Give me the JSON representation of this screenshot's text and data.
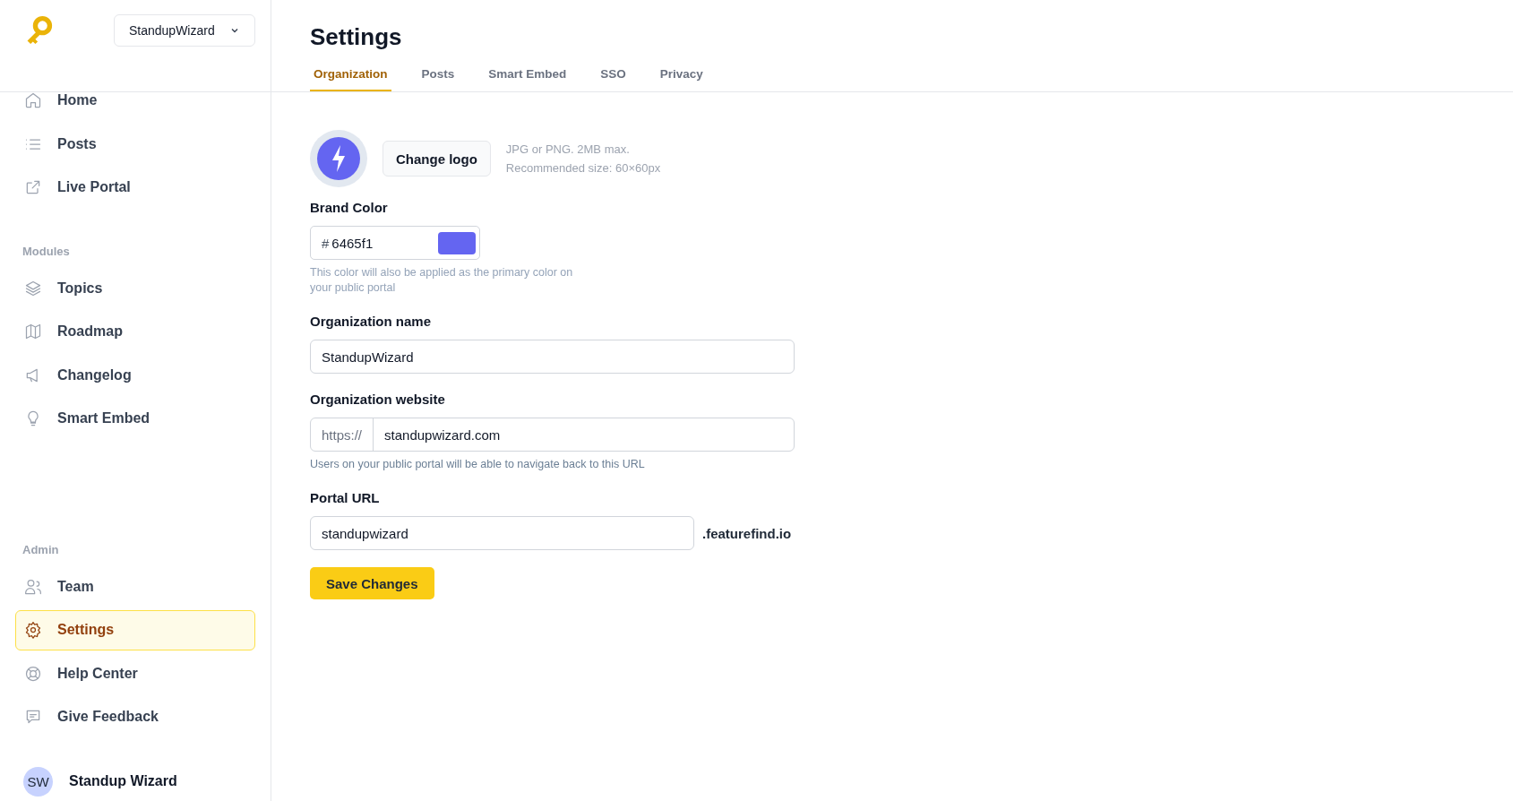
{
  "sidebar": {
    "workspace_select": "StandupWizard",
    "sections": [
      {
        "items": [
          {
            "label": "Home",
            "selected": false
          },
          {
            "label": "Posts",
            "selected": false
          },
          {
            "label": "Live Portal",
            "selected": false
          }
        ]
      },
      {
        "heading": "Modules",
        "items": [
          {
            "label": "Topics",
            "selected": false
          },
          {
            "label": "Roadmap",
            "selected": false
          },
          {
            "label": "Changelog",
            "selected": false
          },
          {
            "label": "Smart Embed",
            "selected": false
          }
        ]
      },
      {
        "heading": "Admin",
        "items": [
          {
            "label": "Team",
            "selected": false
          },
          {
            "label": "Settings",
            "selected": true
          },
          {
            "label": "Help Center",
            "selected": false
          },
          {
            "label": "Give Feedback",
            "selected": false
          }
        ]
      }
    ],
    "user": {
      "initials": "SW",
      "name": "Standup Wizard"
    }
  },
  "page_title": "Settings",
  "tabs": [
    {
      "label": "Organization",
      "selected": true
    },
    {
      "label": "Posts",
      "selected": false
    },
    {
      "label": "Smart Embed",
      "selected": false
    },
    {
      "label": "SSO",
      "selected": false
    },
    {
      "label": "Privacy",
      "selected": false
    }
  ],
  "logo": {
    "color": "#6465f1",
    "button": "Change logo",
    "hint_lines": [
      "JPG or PNG. 2MB max.",
      "Recommended size: 60×60px"
    ]
  },
  "brand_color": {
    "label": "Brand Color",
    "prefix": "#",
    "value": "6465f1",
    "color": "#6465f1",
    "help": "This color will also be applied as the primary color on your public portal"
  },
  "organization_name": {
    "label": "Organization name",
    "value": "StandupWizard"
  },
  "organization_website": {
    "label": "Organization website",
    "prefix": "https://",
    "value": "standupwizard.com",
    "help": "Users on your public portal will be able to navigate back to this URL"
  },
  "portal_url": {
    "label": "Portal URL",
    "value": "standupwizard",
    "suffix": ".featurefind.io"
  },
  "save_button": "Save Changes"
}
